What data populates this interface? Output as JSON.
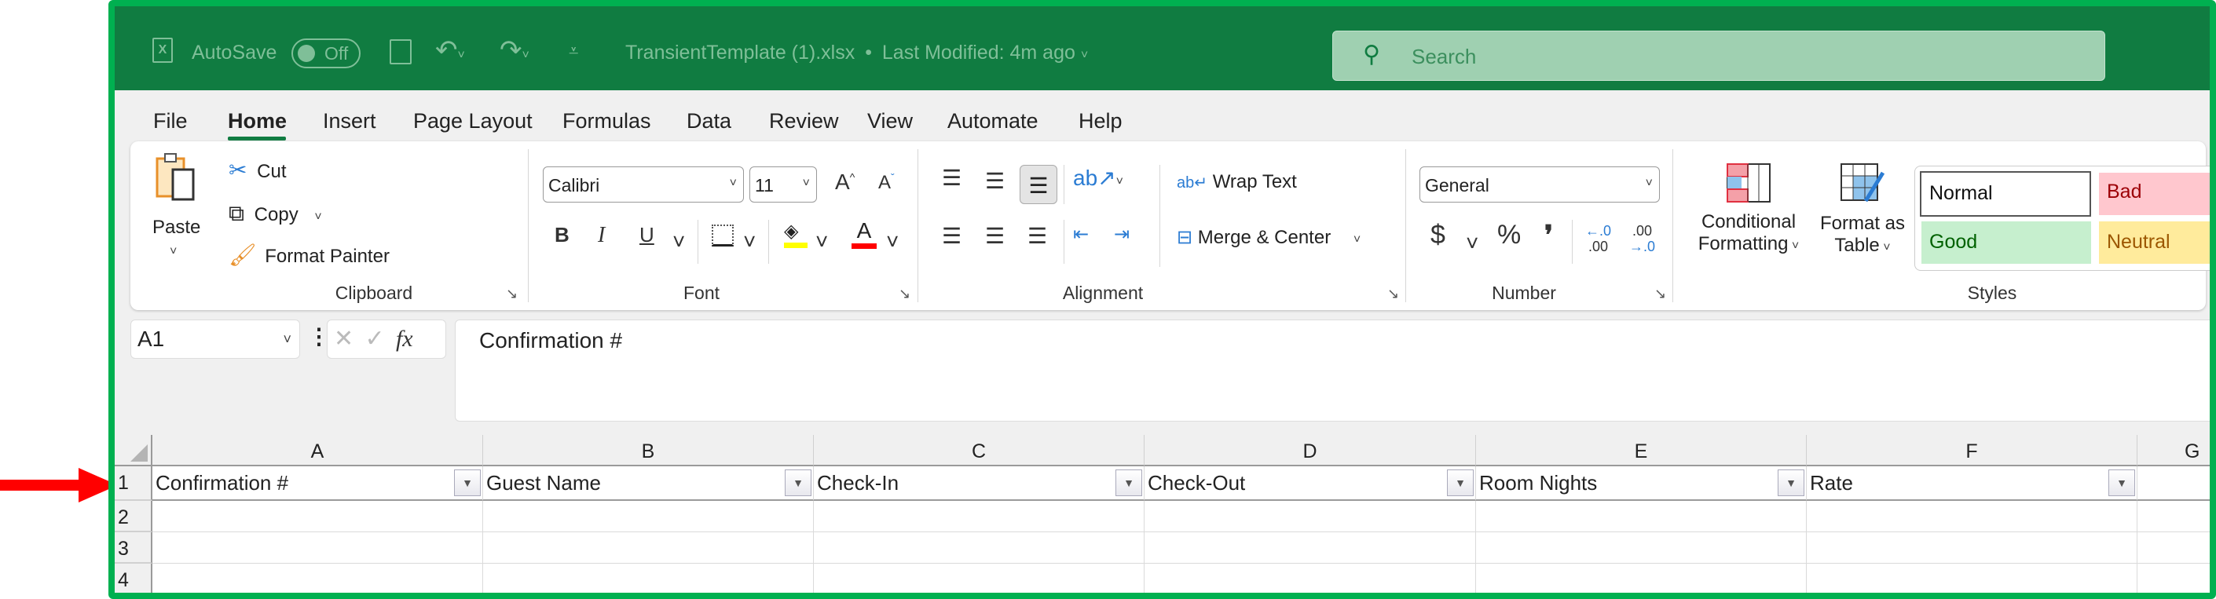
{
  "titlebar": {
    "autosave_label": "AutoSave",
    "autosave_state": "Off",
    "document_title": "TransientTemplate (1).xlsx",
    "separator": "•",
    "last_modified": "Last Modified: 4m ago",
    "search_placeholder": "Search"
  },
  "menu": [
    "File",
    "Home",
    "Insert",
    "Page Layout",
    "Formulas",
    "Data",
    "Review",
    "View",
    "Automate",
    "Help"
  ],
  "active_tab": "Home",
  "ribbon": {
    "clipboard": {
      "paste": "Paste",
      "cut": "Cut",
      "copy": "Copy",
      "format_painter": "Format Painter",
      "label": "Clipboard"
    },
    "font": {
      "font_name": "Calibri",
      "font_size": "11",
      "bold": "B",
      "italic": "I",
      "underline": "U",
      "grow": "A",
      "shrink": "A",
      "font_color": "A",
      "label": "Font",
      "fill_color": "#ffff00",
      "text_color": "#ff0000"
    },
    "alignment": {
      "wrap_text": "Wrap Text",
      "merge_center": "Merge & Center",
      "label": "Alignment"
    },
    "number": {
      "format": "General",
      "currency": "$",
      "percent": "%",
      "comma": "❜",
      "label": "Number"
    },
    "styles": {
      "conditional_line1": "Conditional",
      "conditional_line2": "Formatting",
      "table_line1": "Format as",
      "table_line2": "Table",
      "normal": "Normal",
      "bad": "Bad",
      "good": "Good",
      "neutral": "Neutral",
      "label": "Styles"
    }
  },
  "formula_bar": {
    "name_box": "A1",
    "fx": "fx",
    "content": "Confirmation #"
  },
  "grid": {
    "columns": [
      "A",
      "B",
      "C",
      "D",
      "E",
      "F",
      "G"
    ],
    "rows": [
      "1",
      "2",
      "3",
      "4"
    ],
    "headers": [
      "Confirmation #",
      "Guest Name",
      "Check-In",
      "Check-Out",
      "Room Nights",
      "Rate"
    ]
  },
  "colors": {
    "excel_green": "#107c41",
    "frame_green": "#00b050",
    "arrow": "#ff0000"
  }
}
